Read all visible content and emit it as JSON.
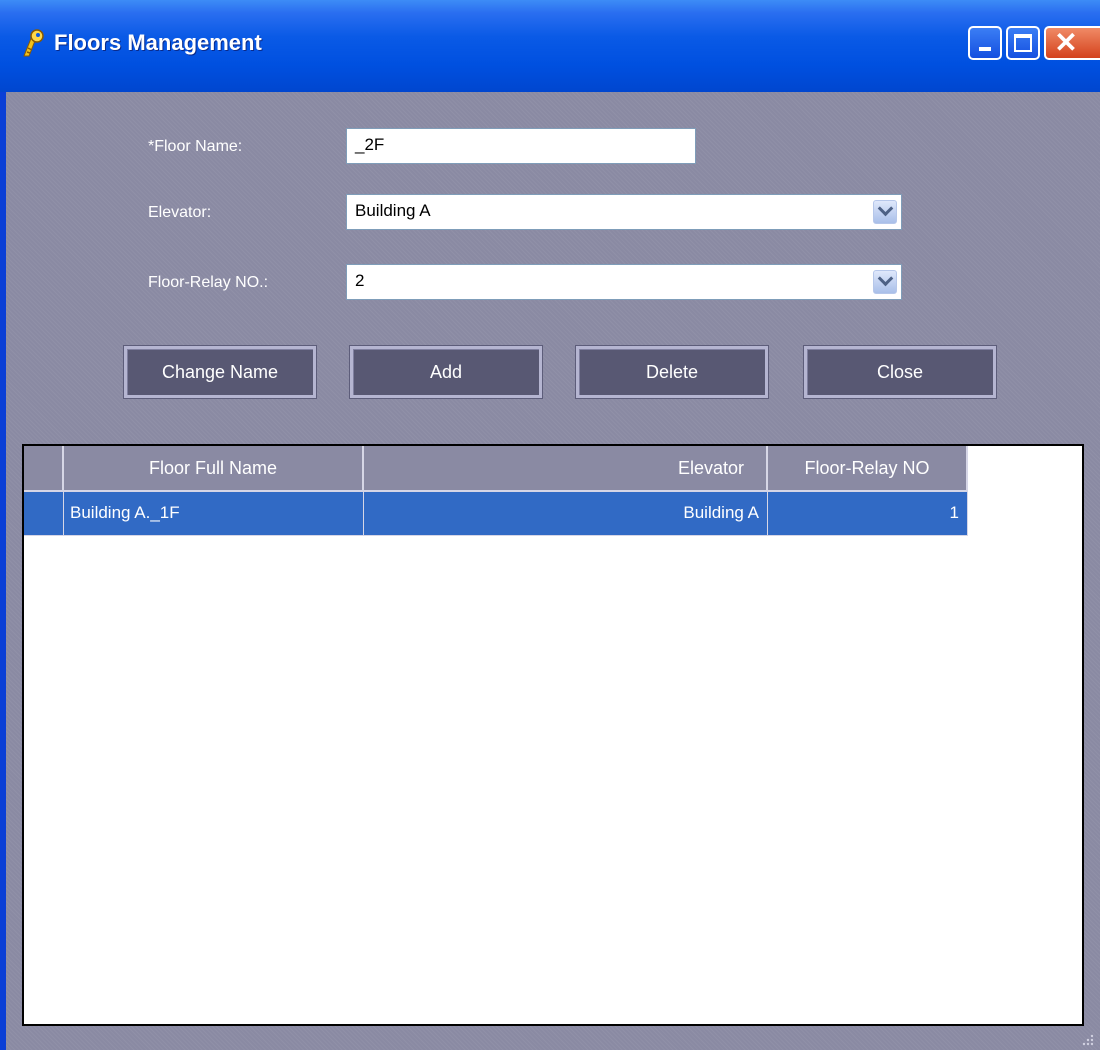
{
  "window": {
    "title": "Floors Management"
  },
  "form": {
    "floor_name": {
      "label": "*Floor Name:",
      "value": "_2F"
    },
    "elevator": {
      "label": "Elevator:",
      "value": "Building A"
    },
    "relay": {
      "label": "Floor-Relay NO.:",
      "value": "2"
    }
  },
  "buttons": {
    "change_name": "Change Name",
    "add": "Add",
    "delete": "Delete",
    "close": "Close"
  },
  "grid": {
    "columns": [
      "Floor Full Name",
      "Elevator",
      "Floor-Relay NO"
    ],
    "rows": [
      {
        "full_name": "Building A._1F",
        "elevator": "Building A",
        "relay": "1",
        "selected": true
      }
    ]
  },
  "colors": {
    "titlebar": "#0054e3",
    "client_bg": "#8a8aa3",
    "button_bg": "#585873",
    "selection": "#316ac5"
  }
}
